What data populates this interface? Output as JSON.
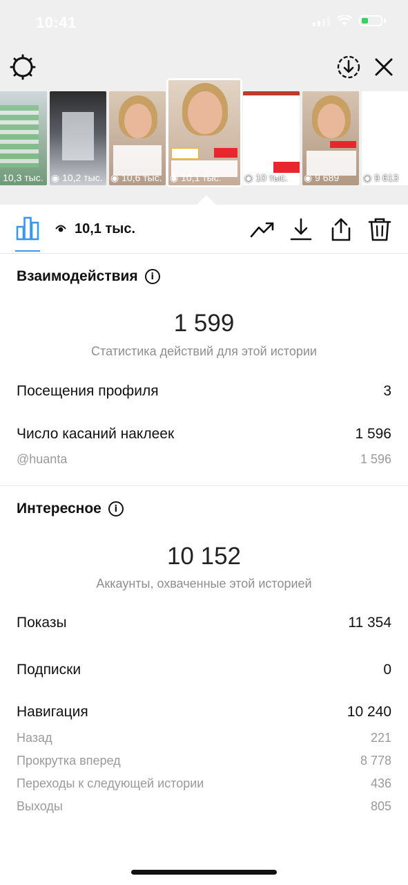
{
  "status_bar": {
    "time": "10:41"
  },
  "thumbnails": [
    {
      "views": "10,3 тыс."
    },
    {
      "views": "10,2 тыс."
    },
    {
      "views": "10,6 тыс."
    },
    {
      "views": "10,1 тыс."
    },
    {
      "views": "10 тыс."
    },
    {
      "views": "9 689"
    },
    {
      "views": "9 613"
    }
  ],
  "toolbar": {
    "views": "10,1 тыс."
  },
  "interactions": {
    "title": "Взаимодействия",
    "total": "1 599",
    "caption": "Статистика действий для этой истории",
    "profile_visits_label": "Посещения профиля",
    "profile_visits_value": "3",
    "sticker_taps_label": "Число касаний наклеек",
    "sticker_taps_value": "1 596",
    "sticker_label": "@huanta",
    "sticker_value": "1 596"
  },
  "discovery": {
    "title": "Интересное",
    "total": "10 152",
    "caption": "Аккаунты, охваченные этой историей",
    "impressions_label": "Показы",
    "impressions_value": "11 354",
    "follows_label": "Подписки",
    "follows_value": "0",
    "navigation_label": "Навигация",
    "navigation_value": "10 240",
    "back_label": "Назад",
    "back_value": "221",
    "forward_label": "Прокрутка вперед",
    "forward_value": "8 778",
    "next_story_label": "Переходы к следующей истории",
    "next_story_value": "436",
    "exits_label": "Выходы",
    "exits_value": "805"
  }
}
